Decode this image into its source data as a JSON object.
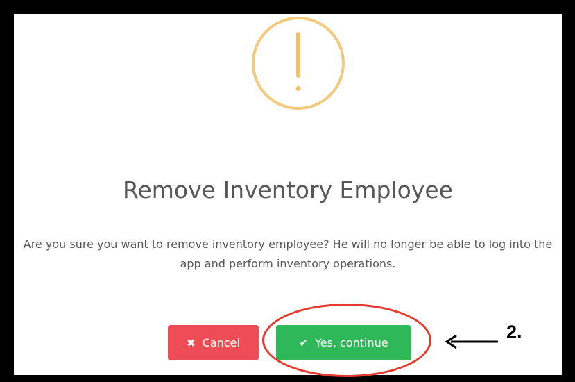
{
  "dialog": {
    "title": "Remove Inventory Employee",
    "message": "Are you sure you want to remove inventory employee? He will no longer be able to log into the app and perform inventory operations.",
    "icon": "warning-exclamation-icon"
  },
  "buttons": {
    "cancel": {
      "label": "Cancel",
      "icon": "x-icon",
      "glyph": "✖"
    },
    "continue": {
      "label": "Yes, continue",
      "icon": "check-icon",
      "glyph": "✔"
    }
  },
  "annotation": {
    "step_label": "2."
  },
  "colors": {
    "frame": "#000000",
    "dialog_background": "#ffffff",
    "warning_icon": "#f3c97c",
    "title_text": "#575757",
    "message_text": "#595959",
    "cancel_button": "#ef4d55",
    "continue_button": "#2eb85a",
    "highlight": "#e53a2d"
  }
}
